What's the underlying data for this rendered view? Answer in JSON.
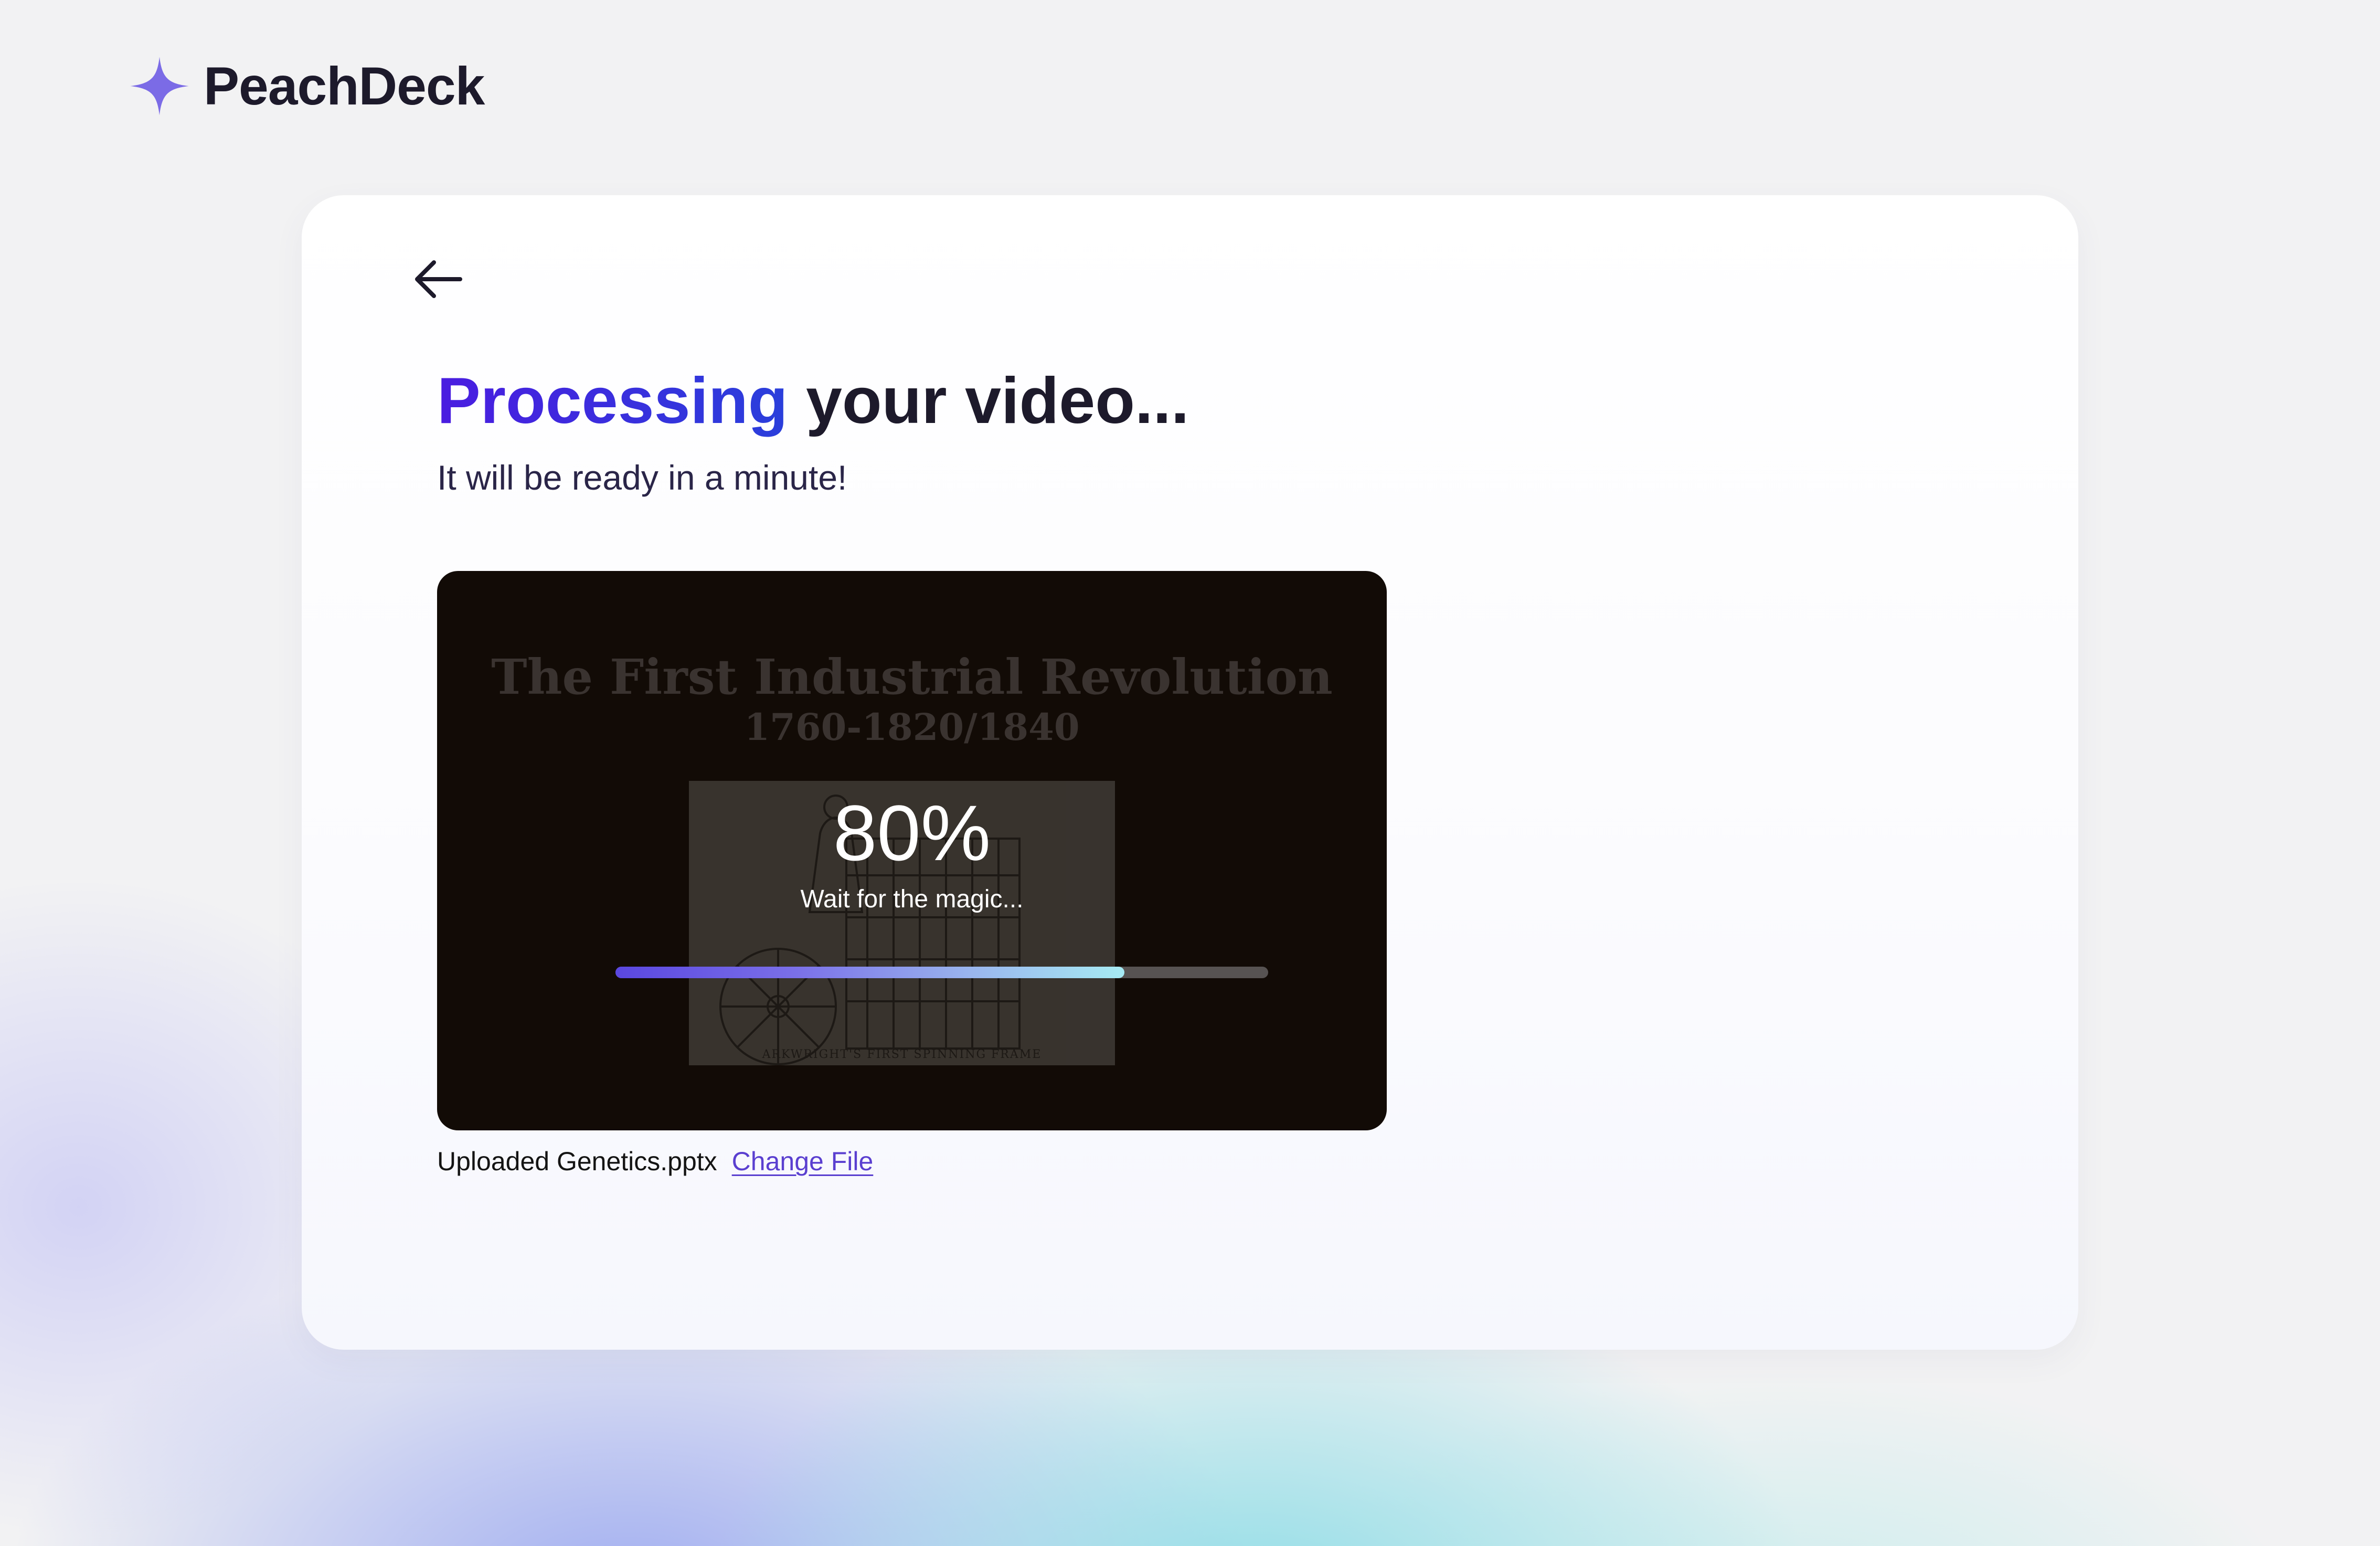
{
  "app": {
    "brand_name": "PeachDeck",
    "logo_icon": "sparkle-icon",
    "brand_color": "#7b6be6"
  },
  "header": {
    "back_icon": "arrow-left-icon"
  },
  "processing": {
    "title_accent": "Processing",
    "title_rest": " your video...",
    "subtitle": "It will be ready in a minute!",
    "accent_color": "#3a22dc"
  },
  "preview": {
    "slide_title": "The First Industrial Revolution",
    "slide_subtitle": "1760-1820/1840",
    "slide_image_caption": "ARKWRIGHT'S FIRST SPINNING FRAME",
    "progress_percent_label": "80%",
    "progress_value": 0.78,
    "progress_message": "Wait for the magic...",
    "progress_start_color": "#5a47e0",
    "progress_end_color": "#a6ebf3"
  },
  "file": {
    "uploaded_label": "Uploaded Genetics.pptx",
    "change_label": "Change File",
    "link_color": "#5a3fd0"
  }
}
